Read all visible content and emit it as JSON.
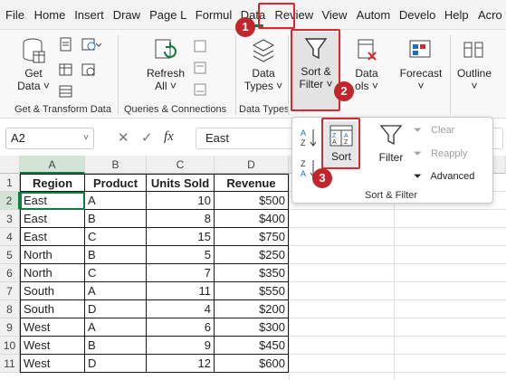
{
  "tabs": [
    "File",
    "Home",
    "Insert",
    "Draw",
    "Page L",
    "Formul",
    "Data",
    "Review",
    "View",
    "Autom",
    "Develo",
    "Help",
    "Acro"
  ],
  "ribbon": {
    "get_data": {
      "line1": "Get",
      "line2": "Data ˅"
    },
    "refresh_all": {
      "line1": "Refresh",
      "line2": "All ˅"
    },
    "data_types": {
      "line1": "Data",
      "line2": "Types ˅"
    },
    "sort_filter": {
      "line1": "Sort &",
      "line2": "Filter ˅"
    },
    "data_tools": {
      "line1": "Data",
      "line2": "ols ˅"
    },
    "forecast": {
      "line1": "Forecast",
      "line2": "˅"
    },
    "outline": {
      "line1": "Outline",
      "line2": "˅"
    },
    "groups": [
      "Get & Transform Data",
      "Queries & Connections",
      "Data Types"
    ]
  },
  "popup": {
    "sort": "Sort",
    "filter": "Filter",
    "clear": "Clear",
    "reapply": "Reapply",
    "advanced": "Advanced",
    "group_label": "Sort & Filter",
    "az": "A↓Z",
    "za": "Z↓A"
  },
  "formula_bar": {
    "cell_ref": "A2",
    "fx": "fx",
    "value": "East"
  },
  "columns": [
    "A",
    "B",
    "C",
    "D"
  ],
  "rows": [
    "1",
    "2",
    "3",
    "4",
    "5",
    "6",
    "7",
    "8",
    "9",
    "10",
    "11"
  ],
  "table": {
    "headers": [
      "Region",
      "Product",
      "Units Sold",
      "Revenue"
    ],
    "data": [
      [
        "East",
        "A",
        "10",
        "$500"
      ],
      [
        "East",
        "B",
        "8",
        "$400"
      ],
      [
        "East",
        "C",
        "15",
        "$750"
      ],
      [
        "North",
        "B",
        "5",
        "$250"
      ],
      [
        "North",
        "C",
        "7",
        "$350"
      ],
      [
        "South",
        "A",
        "11",
        "$550"
      ],
      [
        "South",
        "D",
        "4",
        "$200"
      ],
      [
        "West",
        "A",
        "6",
        "$300"
      ],
      [
        "West",
        "B",
        "9",
        "$450"
      ],
      [
        "West",
        "D",
        "12",
        "$600"
      ]
    ]
  },
  "steps": [
    "1",
    "2",
    "3"
  ],
  "colors": {
    "accent": "#107c41",
    "highlight": "#e0262b",
    "badge": "#c0262b"
  }
}
